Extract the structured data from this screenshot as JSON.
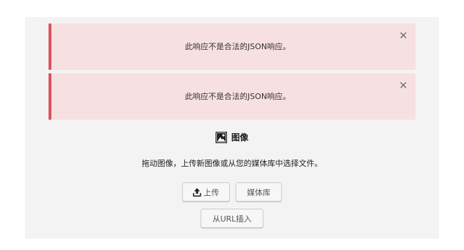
{
  "notices": [
    {
      "message": "此响应不是合法的JSON响应。",
      "dismiss_icon": "close-icon"
    },
    {
      "message": "此响应不是合法的JSON响应。",
      "dismiss_icon": "close-icon"
    }
  ],
  "image_block": {
    "title": "图像",
    "icon": "image-icon",
    "instructions": "拖动图像，上传新图像或从您的媒体库中选择文件。",
    "upload_label": "上传",
    "upload_icon": "upload-icon",
    "media_library_label": "媒体库",
    "insert_from_url_label": "从URL插入"
  },
  "colors": {
    "notice_bg": "#f7e0e1",
    "notice_border": "#d9525e",
    "panel_bg": "#f3f3f3"
  }
}
